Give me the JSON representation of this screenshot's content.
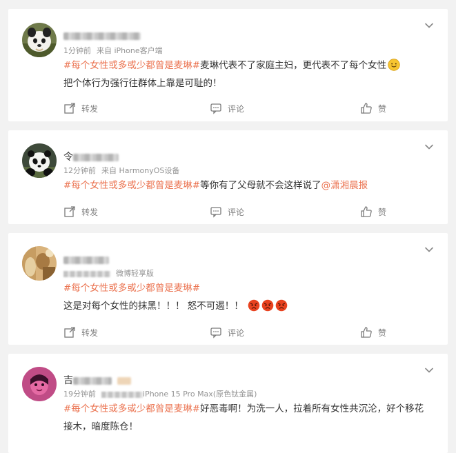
{
  "posts": [
    {
      "name_visible": "",
      "meta_time": "1分钟前",
      "meta_from": "来自 iPhone客户端",
      "hashtag": "#每个女性或多或少都曾是麦琳#",
      "text_line1": "麦琳代表不了家庭主妇，更代表不了每个女性",
      "text_line2": "把个体行为强行往群体上靠是可耻的！",
      "emoji": "smile-emoji",
      "actions": {
        "repost": "转发",
        "comment": "评论",
        "like": "赞"
      }
    },
    {
      "name_visible": "令",
      "meta_time": "12分钟前",
      "meta_from": "来自 HarmonyOS设备",
      "hashtag": "#每个女性或多或少都曾是麦琳#",
      "text_line1": "等你有了父母就不会这样说了",
      "mention": "@潇湘晨报",
      "actions": {
        "repost": "转发",
        "comment": "评论",
        "like": "赞"
      }
    },
    {
      "name_visible": "",
      "meta_from": "微博轻享版",
      "hashtag": "#每个女性或多或少都曾是麦琳#",
      "text_line2": "这是对每个女性的抹黑！！！ 怒不可遏！！",
      "emoji": "angry-emoji",
      "actions": {
        "repost": "转发",
        "comment": "评论",
        "like": "赞"
      }
    },
    {
      "name_visible": "吉",
      "meta_time": "19分钟前",
      "meta_from": "iPhone 15 Pro Max(原色钛金属)",
      "hashtag": "#每个女性或多或少都曾是麦琳#",
      "text_line1": "好恶毒啊！为洗一人，拉着所有女性共沉沦，好个移花",
      "text_line2": "接木，暗度陈仓！"
    }
  ],
  "colors": {
    "accent": "#eb7350",
    "text": "#333333",
    "muted": "#939393",
    "background": "#f2f2f2"
  }
}
